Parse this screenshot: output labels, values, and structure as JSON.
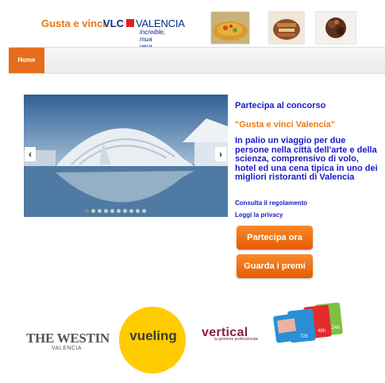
{
  "header": {
    "brand": "Gusta e vinci",
    "vlc_logo": {
      "part1": "VLC",
      "part2": "VALENCIA",
      "tagline": "increible, mua vera"
    },
    "photos": [
      "paella-photo",
      "dish-photo",
      "dessert-photo"
    ]
  },
  "nav": {
    "home_label": "Home"
  },
  "slider": {
    "prev": "‹",
    "next": "›",
    "dot_count": 10,
    "active_dot": 0
  },
  "contest": {
    "title": "Partecipa al concorso",
    "subtitle": "\"Gusta e vinci Valencia\"",
    "description": "In palio un viaggio per due persone nella città dell'arte e della scienza, comprensivo di volo, hotel ed una cena tipica in uno dei migliori ristoranti di Valencia",
    "rules_link": "Consulta il regolamento",
    "privacy_link": "Leggi la privacy",
    "participate_button": "Partecipa ora",
    "prizes_button": "Guarda i premi"
  },
  "sponsors": {
    "westin": "THE WESTIN",
    "westin_sub": "VALENCIA",
    "vueling": "vueling",
    "vertical": "vertical",
    "vertical_sub": "la gestione professionale",
    "cards": [
      "72h",
      "48h",
      "24h"
    ]
  },
  "colors": {
    "accent": "#e36d1d",
    "link_blue": "#1a1ac8",
    "orange_text": "#ea7a14"
  }
}
